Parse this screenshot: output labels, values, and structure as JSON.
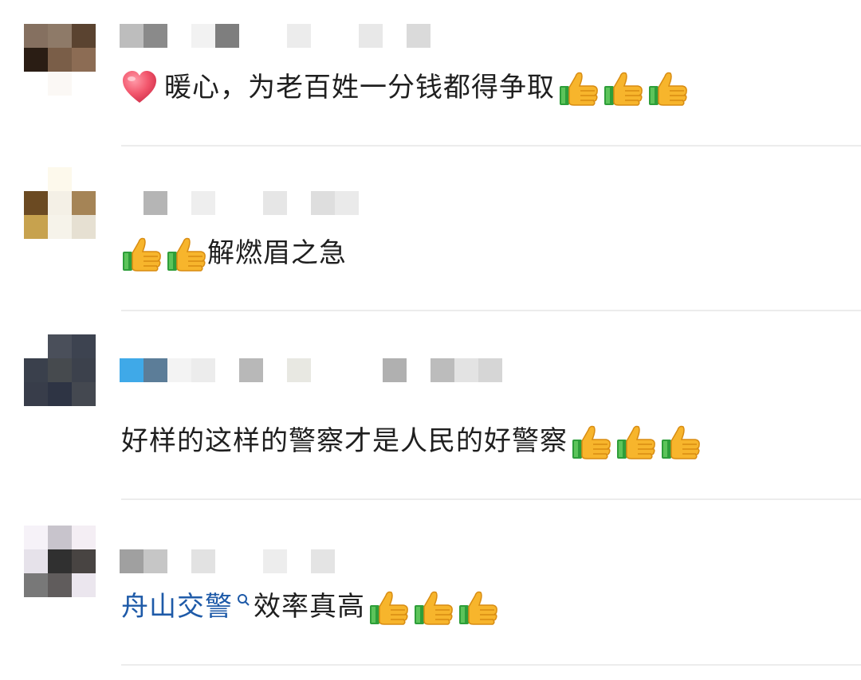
{
  "comments": [
    {
      "text": "暖心，为老百姓一分钱都得争取",
      "leading_icon": "heart-icon",
      "trailing_icons": [
        "thumbs-up-icon",
        "thumbs-up-icon",
        "thumbs-up-icon"
      ]
    },
    {
      "leading_icons": [
        "thumbs-up-icon",
        "thumbs-up-icon"
      ],
      "text": "解燃眉之急"
    },
    {
      "text": "好样的这样的警察才是人民的好警察",
      "trailing_icons": [
        "thumbs-up-icon",
        "thumbs-up-icon",
        "thumbs-up-icon"
      ]
    },
    {
      "mention": "舟山交警",
      "mention_icon": "search-icon",
      "text": "效率真高",
      "trailing_icons": [
        "thumbs-up-icon",
        "thumbs-up-icon",
        "thumbs-up-icon"
      ]
    }
  ],
  "colors": {
    "mention": "#1e5aa8",
    "divider": "#ececec",
    "text": "#1f1f1f"
  }
}
